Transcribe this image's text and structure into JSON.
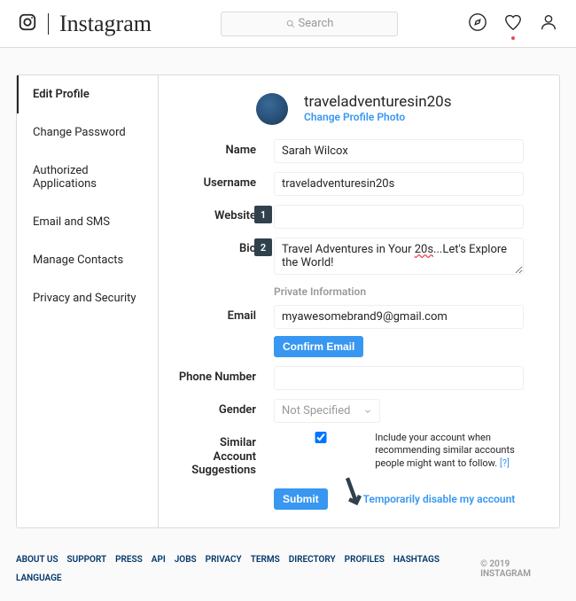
{
  "header": {
    "brand": "Instagram",
    "search_placeholder": "Search"
  },
  "sidebar": {
    "items": [
      {
        "label": "Edit Profile",
        "active": true
      },
      {
        "label": "Change Password",
        "active": false
      },
      {
        "label": "Authorized Applications",
        "active": false
      },
      {
        "label": "Email and SMS",
        "active": false
      },
      {
        "label": "Manage Contacts",
        "active": false
      },
      {
        "label": "Privacy and Security",
        "active": false
      }
    ]
  },
  "profile": {
    "username_display": "traveladventuresin20s",
    "change_photo": "Change Profile Photo"
  },
  "form": {
    "name": {
      "label": "Name",
      "value": "Sarah Wilcox"
    },
    "username": {
      "label": "Username",
      "value": "traveladventuresin20s"
    },
    "website": {
      "label": "Website",
      "value": ""
    },
    "bio": {
      "label": "Bio",
      "value_pre": "Travel Adventures in Your ",
      "value_sq": "20s",
      "value_post": "...Let's Explore the World!"
    },
    "private_heading": "Private Information",
    "email": {
      "label": "Email",
      "value": "myawesomebrand9@gmail.com"
    },
    "confirm_email": "Confirm Email",
    "phone": {
      "label": "Phone Number",
      "value": ""
    },
    "gender": {
      "label": "Gender",
      "value": "Not Specified"
    },
    "similar": {
      "label": "Similar Account Suggestions",
      "text": "Include your account when recommending similar accounts people might want to follow.",
      "help": "[?]"
    },
    "submit": "Submit",
    "disable": "Temporarily disable my account"
  },
  "callouts": {
    "one": "1",
    "two": "2"
  },
  "footer": {
    "links": [
      "ABOUT US",
      "SUPPORT",
      "PRESS",
      "API",
      "JOBS",
      "PRIVACY",
      "TERMS",
      "DIRECTORY",
      "PROFILES",
      "HASHTAGS",
      "LANGUAGE"
    ],
    "copyright": "© 2019 INSTAGRAM"
  }
}
